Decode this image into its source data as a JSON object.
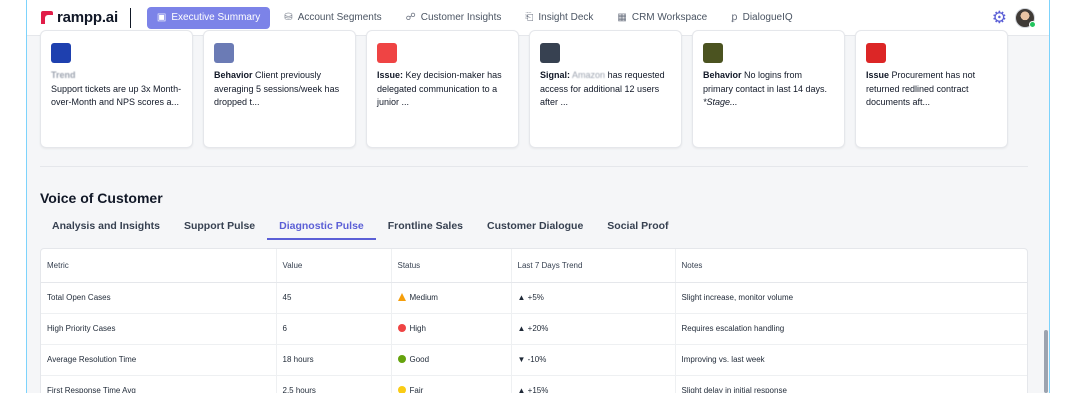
{
  "nav": {
    "logo": "rampp.ai",
    "items": [
      {
        "label": "Executive Summary",
        "icon": "▣",
        "active": true
      },
      {
        "label": "Account Segments",
        "icon": "⛁",
        "active": false
      },
      {
        "label": "Customer Insights",
        "icon": "☍",
        "active": false
      },
      {
        "label": "Insight Deck",
        "icon": "⎗",
        "active": false
      },
      {
        "label": "CRM Workspace",
        "icon": "▦",
        "active": false
      },
      {
        "label": "DialogueIQ",
        "icon": "ꝑ",
        "active": false
      }
    ]
  },
  "cards": [
    {
      "logo_color": "#1e40af",
      "prefix": "Trend",
      "prefix_blurred": true,
      "line_break": true,
      "text": "Support tickets are up 3x Month-over-Month and NPS scores a..."
    },
    {
      "logo_color": "#6b7bb5",
      "prefix": "Behavior",
      "prefix_blurred": false,
      "line_break": false,
      "text": "Client previously averaging 5 sessions/week has dropped t..."
    },
    {
      "logo_color": "#ef4444",
      "prefix": "Issue:",
      "prefix_blurred": false,
      "line_break": false,
      "text": "Key decision-maker has delegated communication to a junior ..."
    },
    {
      "logo_color": "#374151",
      "prefix": "Signal:",
      "prefix_blurred": false,
      "line_break": false,
      "blurred_word": "Amazon",
      "text": "has requested access for additional 12 users after ..."
    },
    {
      "logo_color": "#4b5320",
      "prefix": "Behavior",
      "prefix_blurred": false,
      "line_break": false,
      "text": "No logins from primary contact in last 14 days.",
      "italic": "*Stage..."
    },
    {
      "logo_color": "#dc2626",
      "prefix": "Issue",
      "prefix_blurred": false,
      "line_break": false,
      "text": "Procurement has not returned redlined contract documents aft..."
    }
  ],
  "voc": {
    "title": "Voice of Customer",
    "tabs": [
      "Analysis and Insights",
      "Support Pulse",
      "Diagnostic Pulse",
      "Frontline Sales",
      "Customer Dialogue",
      "Social Proof"
    ],
    "active_tab": 2
  },
  "table": {
    "headers": [
      "Metric",
      "Value",
      "Status",
      "Last 7 Days Trend",
      "Notes"
    ],
    "rows": [
      {
        "metric": "Total Open Cases",
        "value": "45",
        "status": "Medium",
        "status_kind": "warn",
        "trend": "▲ +5%",
        "notes": "Slight increase, monitor volume"
      },
      {
        "metric": "High Priority Cases",
        "value": "6",
        "status": "High",
        "status_kind": "red",
        "trend": "▲ +20%",
        "notes": "Requires escalation handling"
      },
      {
        "metric": "Average Resolution Time",
        "value": "18 hours",
        "status": "Good",
        "status_kind": "green",
        "trend": "▼ -10%",
        "notes": "Improving vs. last week"
      },
      {
        "metric": "First Response Time Avg",
        "value": "2.5 hours",
        "status": "Fair",
        "status_kind": "yellow",
        "trend": "▲ +15%",
        "notes": "Slight delay in initial response"
      }
    ]
  },
  "colors": {
    "red": "#ef4444",
    "green": "#65a30d",
    "yellow": "#facc15",
    "accent": "#5b5fd6"
  }
}
